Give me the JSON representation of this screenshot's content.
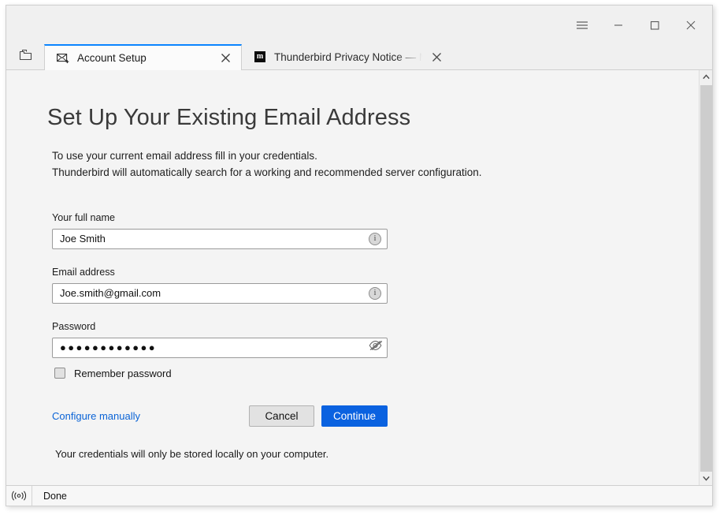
{
  "window": {
    "controls": [
      {
        "name": "app-menu-button",
        "icon": "hamburger-icon",
        "label": "☰"
      },
      {
        "name": "minimize-button",
        "icon": "minimize-icon",
        "label": "—"
      },
      {
        "name": "maximize-button",
        "icon": "maximize-icon",
        "label": "□"
      },
      {
        "name": "close-button",
        "icon": "close-icon",
        "label": "✕"
      }
    ]
  },
  "tabs": {
    "list_all_tabs_icon": "folder-tabs-icon",
    "items": [
      {
        "label": "Account Setup",
        "favicon": "new-mail-icon",
        "active": true,
        "close_label": "✕"
      },
      {
        "label": "Thunderbird Privacy Notice — Mozi",
        "favicon": "mozilla-m-favicon",
        "favicon_text": "m",
        "active": false,
        "close_label": "✕"
      }
    ]
  },
  "page": {
    "heading": "Set Up Your Existing Email Address",
    "intro_line1": "To use your current email address fill in your credentials.",
    "intro_line2": "Thunderbird will automatically search for a working and recommended server configuration.",
    "fields": {
      "full_name": {
        "label": "Your full name",
        "value": "Joe Smith",
        "placeholder": "Your full name",
        "adornment_icon": "info-icon",
        "adornment_glyph": "i"
      },
      "email": {
        "label": "Email address",
        "value": "Joe.smith@gmail.com",
        "placeholder": "Email address",
        "adornment_icon": "info-icon",
        "adornment_glyph": "i"
      },
      "password": {
        "label": "Password",
        "value": "●●●●●●●●●●●●",
        "placeholder": "Password",
        "adornment_icon": "eye-slash-icon",
        "masked": true
      }
    },
    "remember_password": {
      "label": "Remember password",
      "checked": false
    },
    "configure_manually_link": "Configure manually",
    "cancel_button": "Cancel",
    "continue_button": "Continue",
    "footnote": "Your credentials will only be stored locally on your computer."
  },
  "scrollbar": {
    "up_arrow": "▲",
    "down_arrow": "▼"
  },
  "statusbar": {
    "icon": "activity-broadcast-icon",
    "icon_glyph": "((○))",
    "text": "Done"
  },
  "colors": {
    "accent_blue": "#0a62e0",
    "link_blue": "#0a63d6",
    "active_tab_indicator": "#0a84ff",
    "page_background": "#f4f4f4",
    "chrome_background": "#f0f0f0",
    "scrollbar_thumb": "#cdcdcd"
  }
}
